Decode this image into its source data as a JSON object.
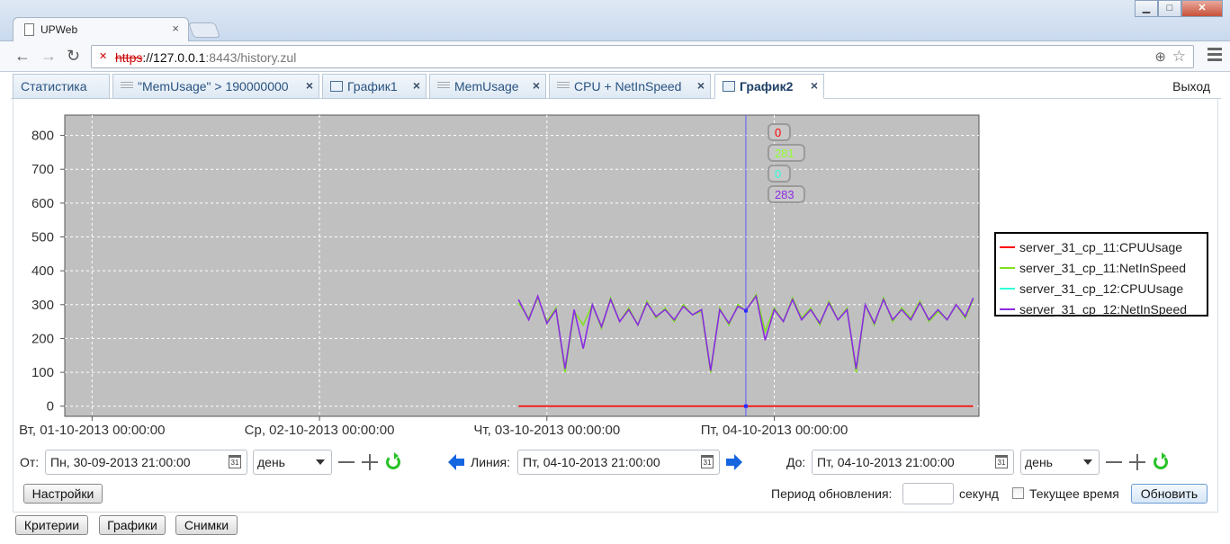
{
  "browser": {
    "tab_title": "UPWeb",
    "url_proto": "https",
    "url_host": "://127.0.0.1",
    "url_rest": ":8443/history.zul",
    "window_buttons": [
      "▁",
      "□",
      "✕"
    ]
  },
  "app_tabs": [
    {
      "label": "Статистика",
      "icon": "none",
      "closable": false,
      "selected": false
    },
    {
      "label": "\"MemUsage\" > 190000000",
      "icon": "grid-icon",
      "closable": true,
      "selected": false
    },
    {
      "label": "График1",
      "icon": "chart-icon",
      "closable": true,
      "selected": false
    },
    {
      "label": "MemUsage",
      "icon": "grid-icon",
      "closable": true,
      "selected": false
    },
    {
      "label": "CPU + NetInSpeed",
      "icon": "grid-icon",
      "closable": true,
      "selected": false
    },
    {
      "label": "График2",
      "icon": "chart-icon",
      "closable": true,
      "selected": true
    }
  ],
  "exit_label": "Выход",
  "chart_data": {
    "type": "line",
    "background": "#c0c0c0",
    "grid": true,
    "legend_position": "right",
    "ylim": [
      -30,
      860
    ],
    "yticks": [
      0,
      100,
      200,
      300,
      400,
      500,
      600,
      700,
      800
    ],
    "x_tick_labels": [
      "Вт, 01-10-2013 00:00:00",
      "Ср, 02-10-2013 00:00:00",
      "Чт, 03-10-2013 00:00:00",
      "Пт, 04-10-2013 00:00:00"
    ],
    "x_range_days": [
      -0.12,
      3.9
    ],
    "cursor_day": 2.875,
    "tooltips": [
      {
        "text": "0",
        "color": "#ff0000"
      },
      {
        "text": "281",
        "color": "#90ff30"
      },
      {
        "text": "0",
        "color": "#30ffd8"
      },
      {
        "text": "283",
        "color": "#8a2be2"
      }
    ],
    "series": [
      {
        "name": "server_31_cp_11:CPUUsage",
        "color": "#ff0000",
        "x": [
          1.875,
          3.875
        ],
        "y": [
          0,
          0
        ]
      },
      {
        "name": "server_31_cp_11:NetInSpeed",
        "color": "#80e020",
        "x": [
          1.875,
          1.92,
          1.96,
          2.0,
          2.04,
          2.08,
          2.12,
          2.16,
          2.2,
          2.24,
          2.28,
          2.32,
          2.36,
          2.4,
          2.44,
          2.48,
          2.52,
          2.56,
          2.6,
          2.64,
          2.68,
          2.72,
          2.76,
          2.8,
          2.84,
          2.875,
          2.92,
          2.96,
          3.0,
          3.04,
          3.08,
          3.12,
          3.16,
          3.2,
          3.24,
          3.28,
          3.32,
          3.36,
          3.4,
          3.44,
          3.48,
          3.52,
          3.56,
          3.6,
          3.64,
          3.68,
          3.72,
          3.76,
          3.8,
          3.84,
          3.875
        ],
        "y": [
          305,
          260,
          320,
          250,
          290,
          100,
          280,
          240,
          300,
          230,
          320,
          250,
          290,
          240,
          310,
          260,
          290,
          250,
          300,
          270,
          280,
          100,
          290,
          240,
          300,
          281,
          330,
          220,
          290,
          250,
          320,
          260,
          290,
          240,
          310,
          255,
          290,
          100,
          300,
          240,
          320,
          250,
          290,
          260,
          310,
          250,
          280,
          255,
          300,
          260,
          315
        ]
      },
      {
        "name": "server_31_cp_12:CPUUsage",
        "color": "#30ffd8",
        "x": [],
        "y": []
      },
      {
        "name": "server_31_cp_12:NetInSpeed",
        "color": "#8a2be2",
        "x": [
          1.875,
          1.92,
          1.96,
          2.0,
          2.04,
          2.08,
          2.12,
          2.16,
          2.2,
          2.24,
          2.28,
          2.32,
          2.36,
          2.4,
          2.44,
          2.48,
          2.52,
          2.56,
          2.6,
          2.64,
          2.68,
          2.72,
          2.76,
          2.8,
          2.84,
          2.875,
          2.92,
          2.96,
          3.0,
          3.04,
          3.08,
          3.12,
          3.16,
          3.2,
          3.24,
          3.28,
          3.32,
          3.36,
          3.4,
          3.44,
          3.48,
          3.52,
          3.56,
          3.6,
          3.64,
          3.68,
          3.72,
          3.76,
          3.8,
          3.84,
          3.875
        ],
        "y": [
          315,
          255,
          325,
          245,
          285,
          110,
          285,
          170,
          300,
          235,
          315,
          250,
          285,
          240,
          305,
          265,
          285,
          255,
          295,
          270,
          285,
          105,
          285,
          245,
          295,
          283,
          325,
          195,
          285,
          250,
          315,
          255,
          285,
          245,
          305,
          255,
          285,
          110,
          300,
          245,
          315,
          255,
          285,
          255,
          305,
          255,
          285,
          255,
          300,
          265,
          320
        ]
      }
    ]
  },
  "controls": {
    "from_label": "От:",
    "from_value": "Пн, 30-09-2013 21:00:00",
    "from_unit": "день",
    "line_label": "Линия:",
    "line_value": "Пт, 04-10-2013 21:00:00",
    "to_label": "До:",
    "to_value": "Пт, 04-10-2013 21:00:00",
    "to_unit": "день",
    "calendar_glyph": "31",
    "settings_label": "Настройки",
    "period_label": "Период обновления:",
    "period_value": "",
    "seconds_label": "секунд",
    "current_time_label": "Текущее время",
    "update_label": "Обновить"
  },
  "bottom_buttons": [
    "Критерии",
    "Графики",
    "Снимки"
  ]
}
